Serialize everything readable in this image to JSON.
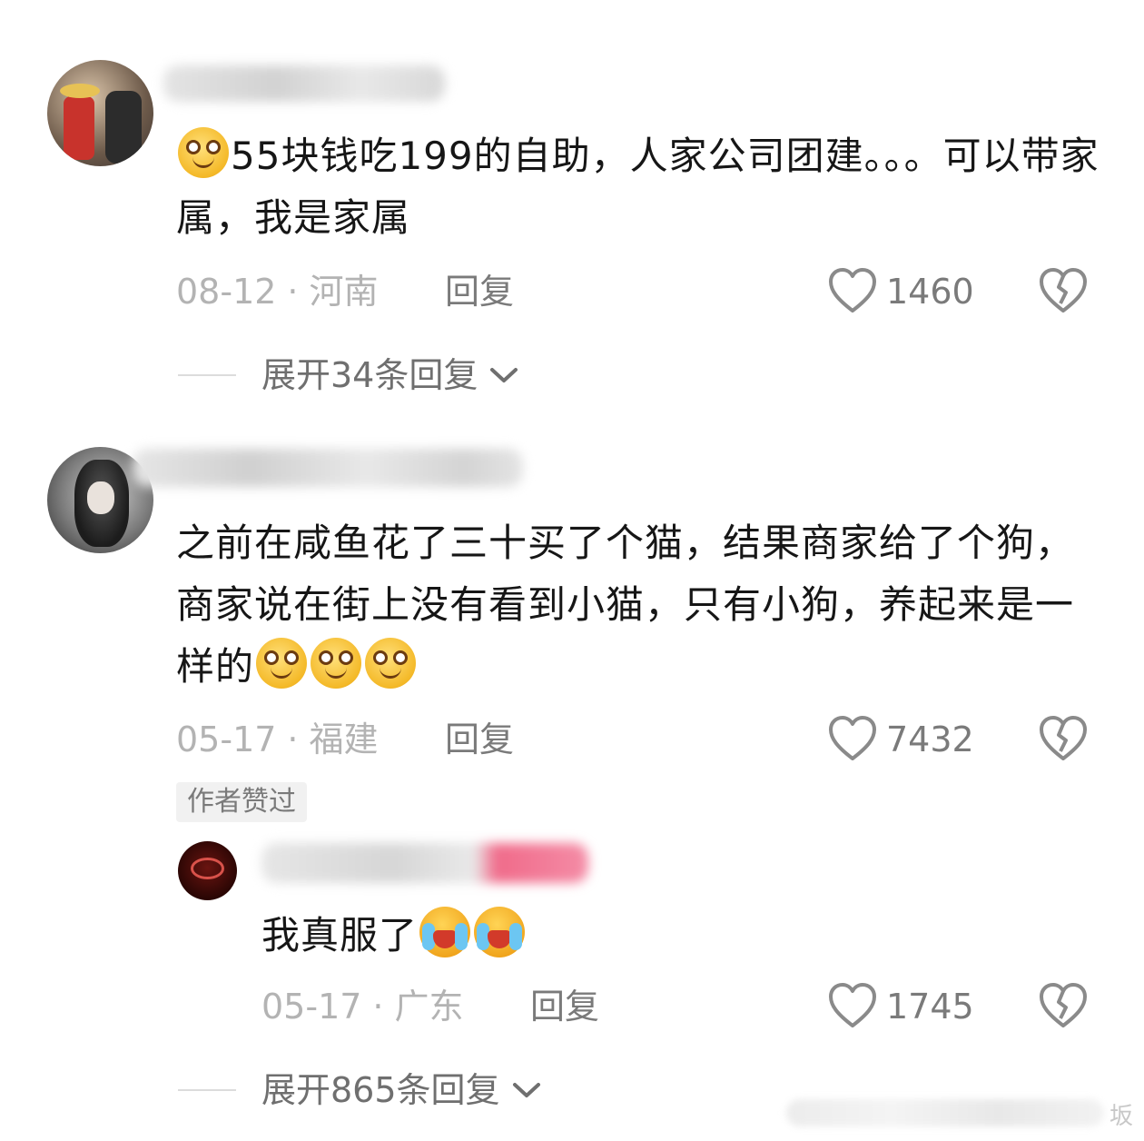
{
  "comments": [
    {
      "text": "55块钱吃199的自助，人家公司团建。。。可以带家属，我是家属",
      "date": "08-12",
      "location": "河南",
      "reply_label": "回复",
      "likes": "1460",
      "expand_label": "展开34条回复"
    },
    {
      "text": "之前在咸鱼花了三十买了个猫，结果商家给了个狗，商家说在街上没有看到小猫，只有小狗，养起来是一样的",
      "date": "05-17",
      "location": "福建",
      "reply_label": "回复",
      "likes": "7432",
      "author_tag": "作者赞过",
      "reply": {
        "text": "我真服了",
        "date": "05-17",
        "location": "广东",
        "reply_label": "回复",
        "likes": "1745"
      },
      "expand_label": "展开865条回复"
    }
  ],
  "separator": "·",
  "watermark": "坂",
  "colors": {
    "accent_pink": "#f06b8a",
    "meta_gray": "#b3b3b3"
  },
  "icons": [
    "heart-outline-icon",
    "dislike-broken-heart-icon",
    "chevron-down-icon",
    "smile-emoji-icon",
    "laugh-cry-emoji-icon"
  ]
}
